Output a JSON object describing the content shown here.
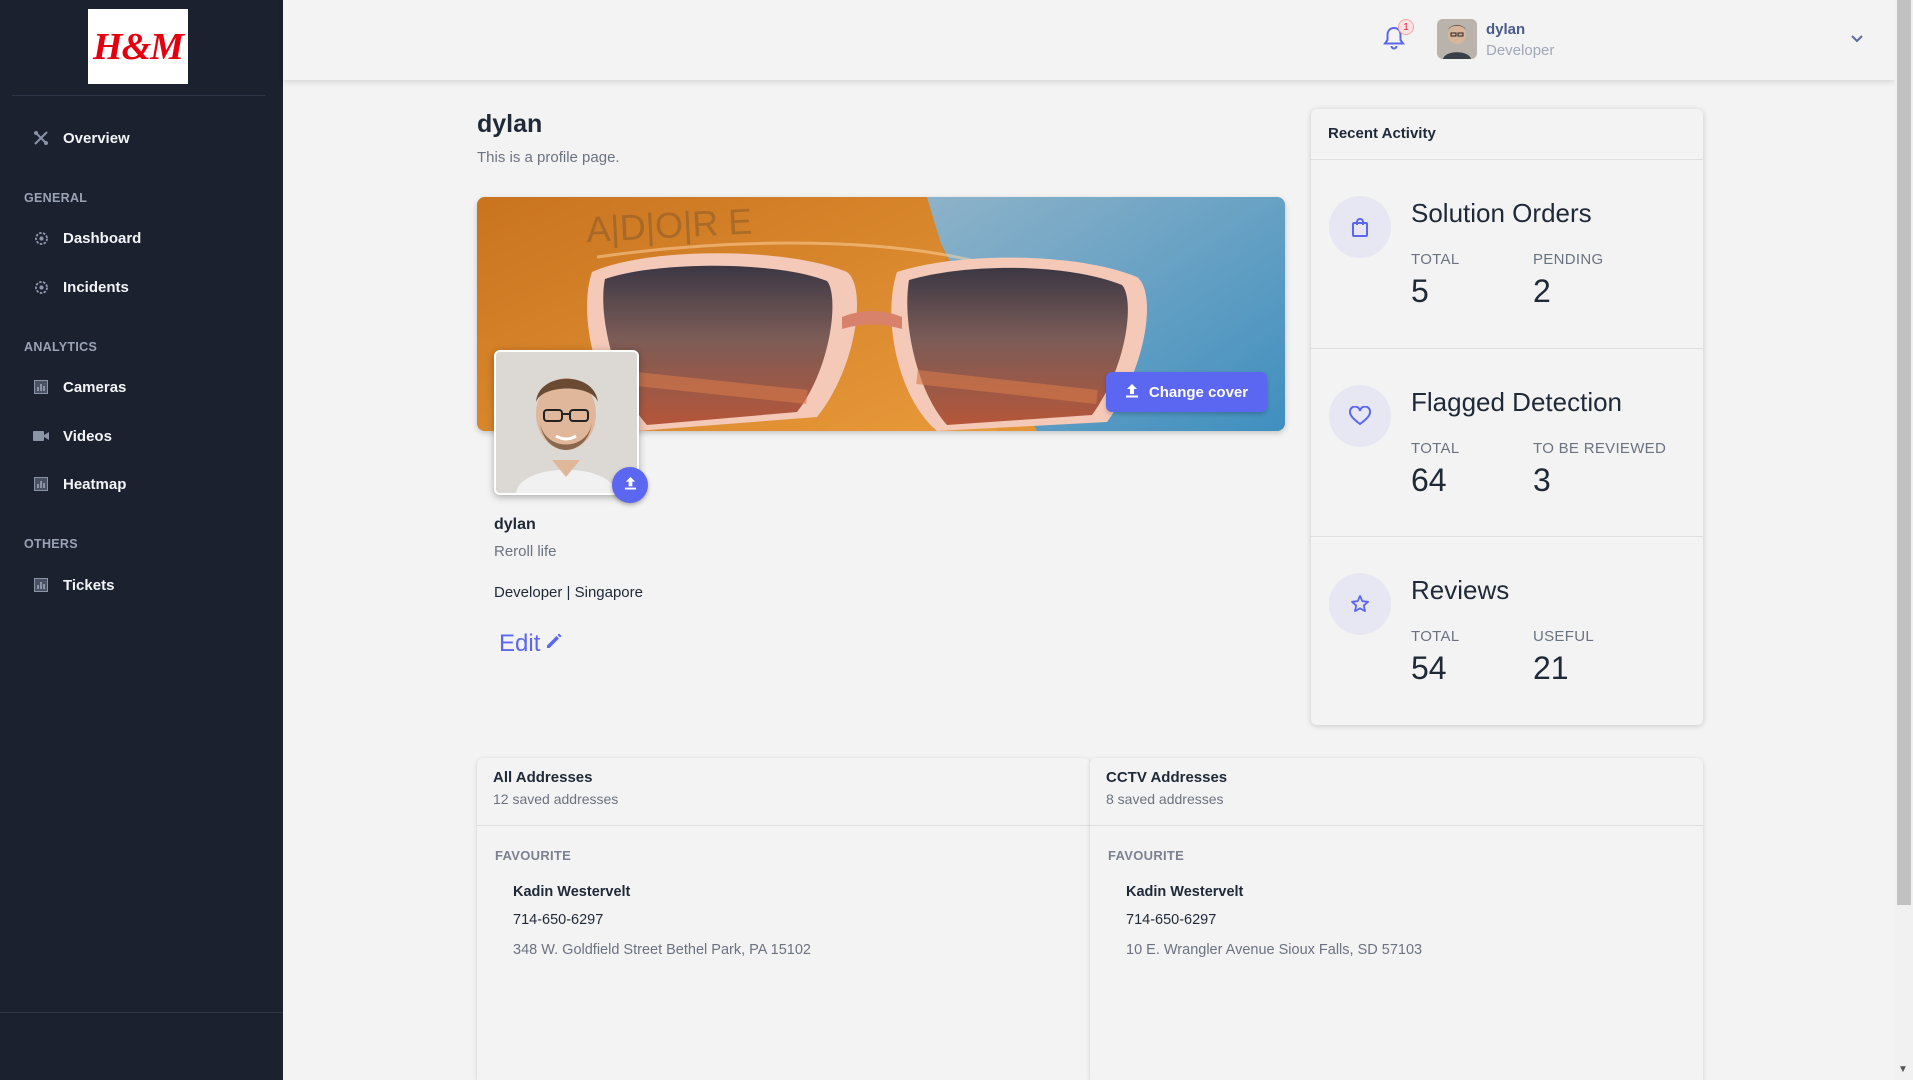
{
  "brand": {
    "logo_text": "H&M",
    "accent": "#5b67f0",
    "sidebar_bg": "#1c2130"
  },
  "sidebar": {
    "overview": "Overview",
    "sections": [
      {
        "title": "GENERAL",
        "items": [
          {
            "label": "Dashboard",
            "icon": "gear-icon"
          },
          {
            "label": "Incidents",
            "icon": "gear-icon"
          }
        ]
      },
      {
        "title": "ANALYTICS",
        "items": [
          {
            "label": "Cameras",
            "icon": "chart-icon"
          },
          {
            "label": "Videos",
            "icon": "video-icon"
          },
          {
            "label": "Heatmap",
            "icon": "chart-icon"
          }
        ]
      },
      {
        "title": "OTHERS",
        "items": [
          {
            "label": "Tickets",
            "icon": "chart-icon"
          }
        ]
      }
    ]
  },
  "topbar": {
    "notification_count": "1",
    "user_name": "dylan",
    "user_role": "Developer"
  },
  "profile": {
    "title": "dylan",
    "subtitle": "This is a profile page.",
    "change_cover_label": "Change cover",
    "name": "dylan",
    "tagline": "Reroll life",
    "meta": "Developer | Singapore",
    "edit_label": "Edit"
  },
  "activity": {
    "title": "Recent Activity",
    "blocks": [
      {
        "title": "Solution Orders",
        "icon": "shopping-bag-icon",
        "label1": "TOTAL",
        "value1": "5",
        "label2": "PENDING",
        "value2": "2"
      },
      {
        "title": "Flagged Detection",
        "icon": "heart-icon",
        "label1": "TOTAL",
        "value1": "64",
        "label2": "TO BE REVIEWED",
        "value2": "3"
      },
      {
        "title": "Reviews",
        "icon": "star-icon",
        "label1": "TOTAL",
        "value1": "54",
        "label2": "USEFUL",
        "value2": "21"
      }
    ]
  },
  "addresses": [
    {
      "title": "All Addresses",
      "count": "12 saved addresses",
      "section": "FAVOURITE",
      "person": "Kadin Westervelt",
      "phone": "714-650-6297",
      "address": "348 W. Goldfield Street Bethel Park, PA 15102"
    },
    {
      "title": "CCTV Addresses",
      "count": "8 saved addresses",
      "section": "FAVOURITE",
      "person": "Kadin Westervelt",
      "phone": "714-650-6297",
      "address": "10 E. Wrangler Avenue Sioux Falls, SD 57103"
    }
  ]
}
